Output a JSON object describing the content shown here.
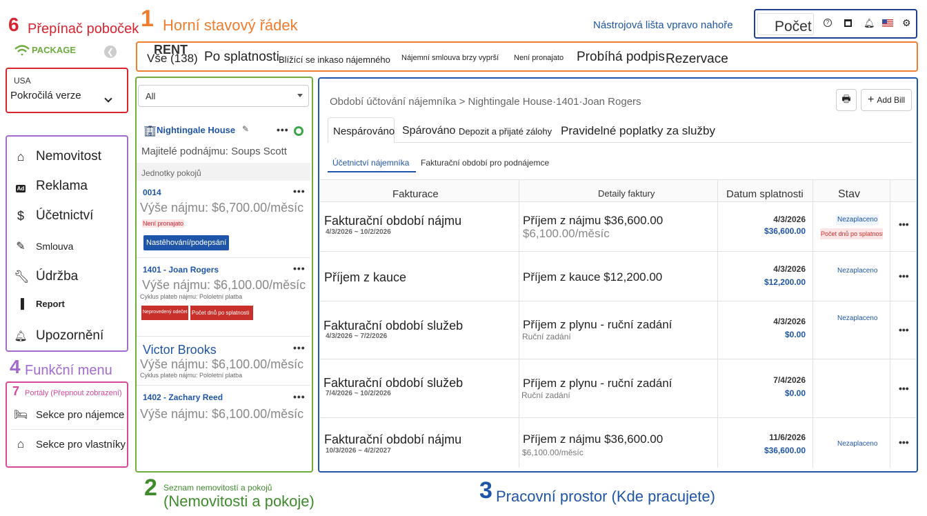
{
  "annotations": {
    "a1": {
      "num": "1",
      "label": "Horní stavový řádek"
    },
    "a2": {
      "num": "2",
      "small": "Seznam nemovitostí a pokojů",
      "label": "(Nemovitosti a pokoje)"
    },
    "a3": {
      "num": "3",
      "label": "Pracovní prostor (Kde pracujete)"
    },
    "a4": {
      "num": "4",
      "label": "Funkční menu"
    },
    "a6": {
      "num": "6",
      "label": "Přepínač poboček"
    },
    "a7": {
      "num": "7",
      "label": "Portály (Přepnout zobrazení)"
    },
    "toolbar": "Nástrojová lišta vpravo nahoře"
  },
  "toolbar": {
    "count_label": "Počet"
  },
  "logo": {
    "rent": "RENT",
    "package": "PACKAGE"
  },
  "branch": {
    "region": "USA",
    "version": "Pokročilá verze"
  },
  "menu": [
    {
      "label": "Nemovitost",
      "icon": "home-icon"
    },
    {
      "label": "Reklama",
      "icon": "ad-icon"
    },
    {
      "label": "Účetnictví",
      "icon": "dollar-icon"
    },
    {
      "label": "Smlouva",
      "icon": "contract-icon"
    },
    {
      "label": "Údržba",
      "icon": "wrench-icon"
    },
    {
      "label": "Report",
      "icon": "chart-icon"
    },
    {
      "label": "Upozornění",
      "icon": "bell-icon"
    }
  ],
  "portals": [
    {
      "label": "Sekce pro nájemce",
      "icon": "bed-icon"
    },
    {
      "label": "Sekce pro vlastníky",
      "icon": "house-user-icon"
    }
  ],
  "top_tabs": [
    {
      "label": "Vše (138)"
    },
    {
      "label": "Po splatnosti"
    },
    {
      "label": "Blížící se inkaso nájemného"
    },
    {
      "label": "Nájemní smlouva brzy vyprší"
    },
    {
      "label": "Není pronajato"
    },
    {
      "label": "Probíhá podpis"
    },
    {
      "label": "Rezervace"
    }
  ],
  "property_list": {
    "filter": "All",
    "property_name": "Nightingale House",
    "sublease_owners": "Majitelé podnájmu: Soups Scott",
    "units_header": "Jednotky pokojů",
    "units": [
      {
        "title": "0014",
        "rent": "Výše nájmu: $6,700.00/měsíc",
        "tag": "Není pronajato",
        "button": "Nastěhování/podepsání"
      },
      {
        "title": "1401 - Joan Rogers",
        "rent": "Výše nájmu: $6,100.00/měsíc",
        "cycle": "Cyklus plateb nájmu: Pololetní platba",
        "tag1": "Neprovedený odečet",
        "tag2": "Počet dnů po splatnosti"
      },
      {
        "title": "Victor Brooks",
        "rent": "Výše nájmu: $6,100.00/měsíc",
        "cycle": "Cyklus plateb nájmu: Pololetní platba"
      },
      {
        "title": "1402 - Zachary Reed",
        "rent": "Výše nájmu: $6,100.00/měsíc"
      }
    ]
  },
  "workspace": {
    "breadcrumb": "Období účtování nájemníka > Nightingale House·1401·Joan Rogers",
    "add_bill": "Add Bill",
    "tabs": [
      "Nespárováno",
      "Spárováno",
      "Depozit a přijaté zálohy",
      "Pravidelné poplatky za služby"
    ],
    "subtabs": [
      "Účetnictví nájemníka",
      "Fakturační období pro podnájemce"
    ],
    "columns": [
      "Fakturace",
      "Detaily faktury",
      "Datum splatnosti",
      "Stav"
    ],
    "rows": [
      {
        "title": "Fakturační období nájmu",
        "period": "4/3/2026 ~ 10/2/2026",
        "detail": "Příjem z nájmu $36,600.00",
        "detail2": "$6,100.00/měsíc",
        "date": "4/3/2026",
        "amount": "$36,600.00",
        "status": "Nezaplaceno",
        "overdue": "Počet dnů po splatnosti"
      },
      {
        "title": "Příjem z kauce",
        "period": "",
        "detail": "Příjem z kauce $12,200.00",
        "detail2": "",
        "date": "4/3/2026",
        "amount": "$12,200.00",
        "status": "Nezaplaceno"
      },
      {
        "title": "Fakturační období služeb",
        "period": "4/3/2026 ~ 7/2/2026",
        "detail": "Příjem z plynu - ruční zadání",
        "detail2": "Ruční zadání",
        "date": "4/3/2026",
        "amount": "$0.00",
        "status": "Nezaplaceno"
      },
      {
        "title": "Fakturační období služeb",
        "period": "7/4/2026 ~ 10/2/2026",
        "detail": "Příjem z plynu - ruční zadání",
        "detail2": "Ruční zadání",
        "date": "7/4/2026",
        "amount": "$0.00",
        "status": ""
      },
      {
        "title": "Fakturační období nájmu",
        "period": "10/3/2026 ~ 4/2/2027",
        "detail": "Příjem z nájmu $36,600.00",
        "detail2": "$6,100.00/měsíc",
        "date": "11/6/2026",
        "amount": "$36,600.00",
        "status": "Nezaplaceno"
      }
    ]
  }
}
